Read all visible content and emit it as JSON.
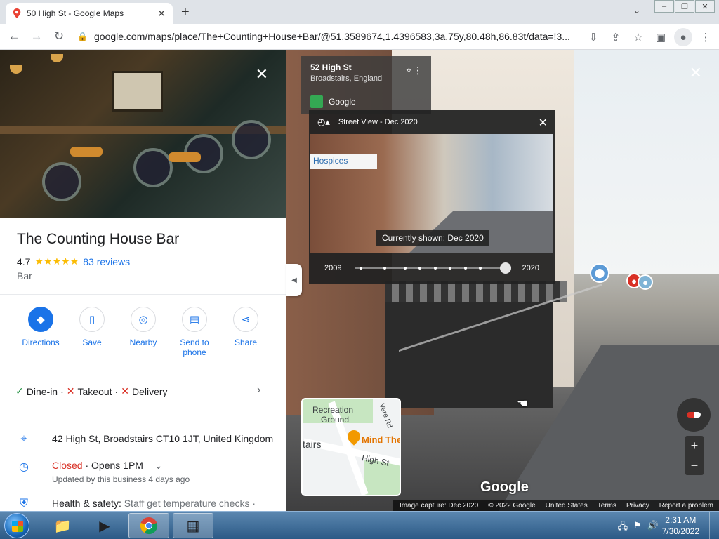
{
  "browser": {
    "tab_title": "50 High St - Google Maps",
    "url": "google.com/maps/place/The+Counting+House+Bar/@51.3589674,1.4396583,3a,75y,80.48h,86.83t/data=!3..."
  },
  "place": {
    "name": "The Counting House Bar",
    "rating": "4.7",
    "stars": "★★★★★",
    "reviews": "83 reviews",
    "category": "Bar"
  },
  "actions": [
    {
      "label": "Directions",
      "icon": "directions-icon"
    },
    {
      "label": "Save",
      "icon": "bookmark-icon"
    },
    {
      "label": "Nearby",
      "icon": "nearby-icon"
    },
    {
      "label": "Send to phone",
      "icon": "send-to-phone-icon"
    },
    {
      "label": "Share",
      "icon": "share-icon"
    }
  ],
  "services": {
    "dine_in": "Dine-in",
    "takeout": "Takeout",
    "delivery": "Delivery",
    "sep": "·"
  },
  "info": {
    "address": "42 High St, Broadstairs CT10 1JT, United Kingdom",
    "hours_status": "Closed",
    "hours_next": "· Opens 1PM",
    "updated": "Updated by this business 4 days ago",
    "health_label": "Health & safety:",
    "health_value": "Staff get temperature checks ·"
  },
  "streetview": {
    "address_title": "52 High St",
    "address_sub": "Broadstairs, England",
    "provider": "Google",
    "timeline_title": "Street View - Dec 2020",
    "currently_shown": "Currently shown: Dec 2020",
    "year_start": "2009",
    "year_end": "2020",
    "thumb_sign": "Hospices",
    "map_labels": {
      "ground1": "Recreation",
      "ground2": "Ground",
      "stairs": "tairs",
      "place": "Mind The",
      "street": "High St",
      "vere": "Vere Rd"
    },
    "logo": "Google",
    "attribution": [
      "Image capture: Dec 2020",
      "© 2022 Google",
      "United States",
      "Terms",
      "Privacy",
      "Report a problem"
    ]
  },
  "taskbar": {
    "time": "2:31 AM",
    "date": "7/30/2022"
  }
}
